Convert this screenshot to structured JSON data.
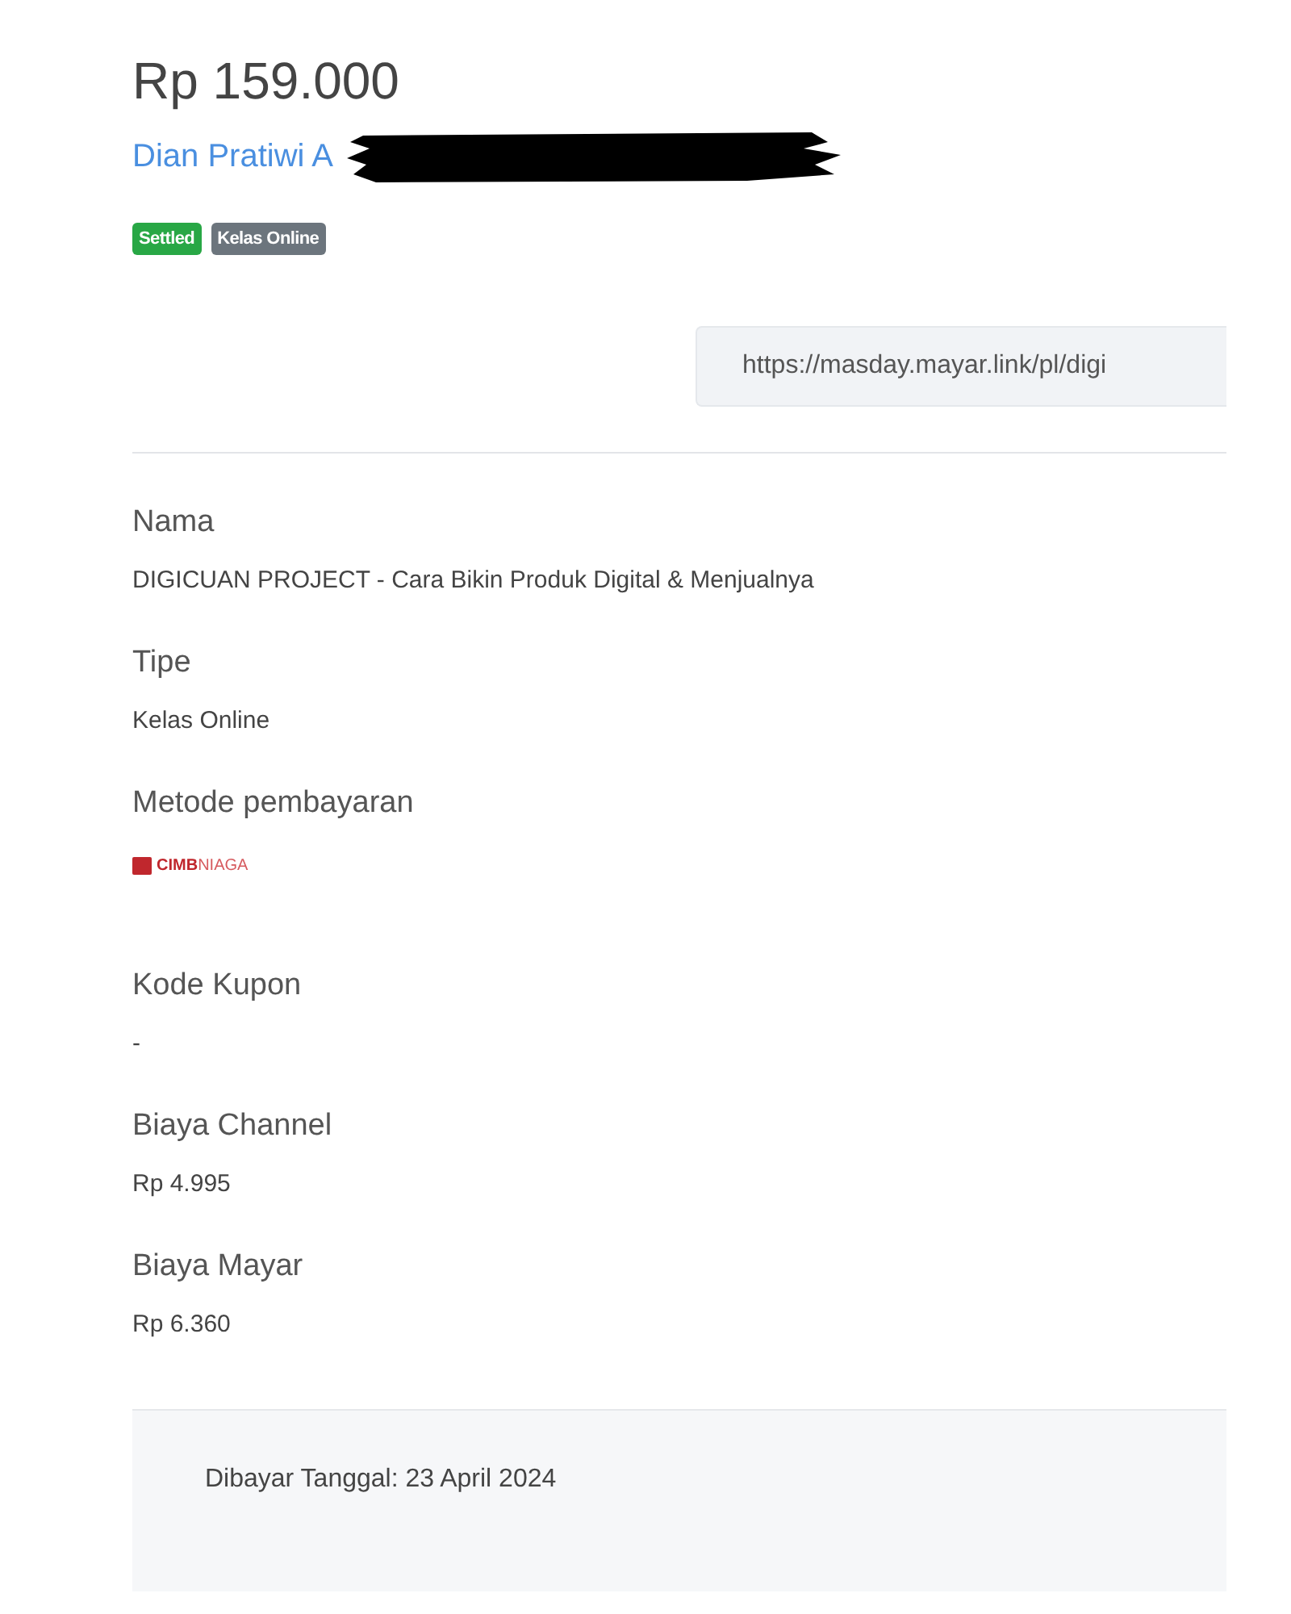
{
  "amount": "Rp 159.000",
  "customer": {
    "name": "Dian Pratiwi A",
    "redacted": true
  },
  "badges": [
    {
      "label": "Settled",
      "color": "#28a745"
    },
    {
      "label": "Kelas Online",
      "color": "#6c757d"
    }
  ],
  "link": {
    "value": "https://masday.mayar.link/pl/digi"
  },
  "details": [
    {
      "kind": "text",
      "label": "Nama",
      "value": "DIGICUAN PROJECT - Cara Bikin Produk Digital & Menjualnya"
    },
    {
      "kind": "text",
      "label": "Tipe",
      "value": "Kelas Online"
    },
    {
      "kind": "logo",
      "label": "Metode pembayaran",
      "logo_bold": "CIMB",
      "logo_light": "NIAGA"
    },
    {
      "kind": "text",
      "label": "Kode Kupon",
      "value": "-"
    },
    {
      "kind": "text",
      "label": "Biaya Channel",
      "value": "Rp 4.995"
    },
    {
      "kind": "text",
      "label": "Biaya Mayar",
      "value": "Rp 6.360"
    }
  ],
  "footer": {
    "text": "Dibayar Tanggal: 23 April 2024"
  }
}
